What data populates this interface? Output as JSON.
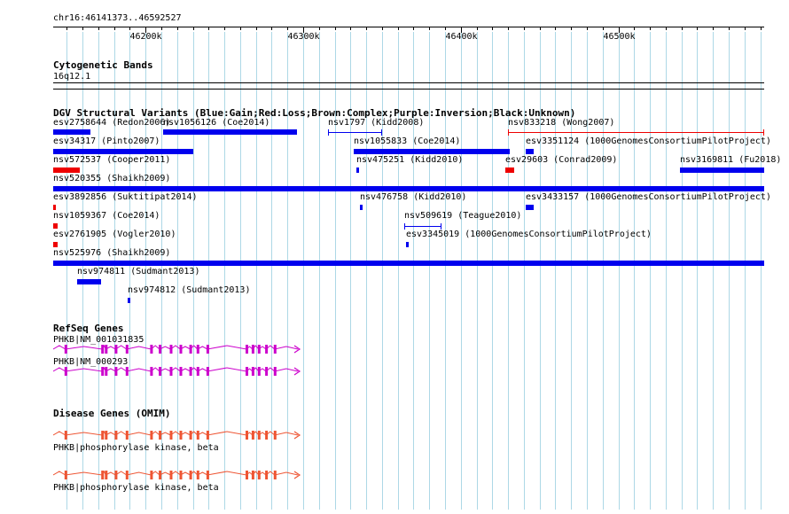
{
  "browser": {
    "location": "chr16:46141373..46592527",
    "ruler": {
      "start": 46141373,
      "end": 46592527,
      "ticks": [
        {
          "pos": 46200000,
          "label": "46200k"
        },
        {
          "pos": 46300000,
          "label": "46300k"
        },
        {
          "pos": 46400000,
          "label": "46400k"
        },
        {
          "pos": 46500000,
          "label": "46500k"
        }
      ]
    }
  },
  "colors": {
    "gain": "#0000ee",
    "loss": "#ee0000",
    "gridline": "#add8e6",
    "refseq": "#cc00cc",
    "omim": "#ee5533"
  },
  "tracks": {
    "cytoband": {
      "title": "Cytogenetic Bands",
      "band": "16q12.1"
    },
    "dgv": {
      "title": "DGV Structural Variants (Blue:Gain;Red:Loss;Brown:Complex;Purple:Inversion;Black:Unknown)",
      "features": [
        {
          "label": "esv2758644 (Redon2006)",
          "type": "gain",
          "style": "bar",
          "start": 46141373,
          "end": 46165000
        },
        {
          "label": "nsv1056126 (Coe2014)",
          "type": "gain",
          "style": "bar",
          "start": 46211000,
          "end": 46296000
        },
        {
          "label": "nsv1797 (Kidd2008)",
          "type": "gain",
          "style": "line",
          "start": 46316000,
          "end": 46350000
        },
        {
          "label": "nsv833218 (Wong2007)",
          "type": "loss",
          "style": "line",
          "start": 46430000,
          "end": 46592527
        },
        {
          "label": "esv34317 (Pinto2007)",
          "type": "gain",
          "style": "bar",
          "start": 46141373,
          "end": 46230000
        },
        {
          "label": "nsv1055833 (Coe2014)",
          "type": "gain",
          "style": "bar",
          "start": 46332000,
          "end": 46431000
        },
        {
          "label": "esv3351124 (1000GenomesConsortiumPilotProject)",
          "type": "gain",
          "style": "bar",
          "start": 46441000,
          "end": 46446000
        },
        {
          "label": "nsv572537 (Cooper2011)",
          "type": "loss",
          "style": "bar",
          "start": 46141373,
          "end": 46158000
        },
        {
          "label": "nsv475251 (Kidd2010)",
          "type": "gain",
          "style": "bar",
          "start": 46333500,
          "end": 46334800
        },
        {
          "label": "esv29603 (Conrad2009)",
          "type": "loss",
          "style": "bar",
          "start": 46428000,
          "end": 46434000
        },
        {
          "label": "nsv3169811 (Fu2018)",
          "type": "gain",
          "style": "bar",
          "start": 46539000,
          "end": 46592527
        },
        {
          "label": "nsv520355 (Shaikh2009)",
          "type": "gain",
          "style": "bar",
          "start": 46141373,
          "end": 46592527
        },
        {
          "label": "esv3892856 (Suktitipat2014)",
          "type": "loss",
          "style": "bar",
          "start": 46141373,
          "end": 46143000
        },
        {
          "label": "nsv476758 (Kidd2010)",
          "type": "gain",
          "style": "bar",
          "start": 46336000,
          "end": 46337300
        },
        {
          "label": "esv3433157 (1000GenomesConsortiumPilotProject)",
          "type": "gain",
          "style": "bar",
          "start": 46441000,
          "end": 46446000
        },
        {
          "label": "nsv1059367 (Coe2014)",
          "type": "loss",
          "style": "bar",
          "start": 46141373,
          "end": 46144000
        },
        {
          "label": "nsv509619 (Teague2010)",
          "type": "gain",
          "style": "line",
          "start": 46364000,
          "end": 46388000
        },
        {
          "label": "esv2761905 (Vogler2010)",
          "type": "loss",
          "style": "bar",
          "start": 46141373,
          "end": 46144000
        },
        {
          "label": "esv3345019 (1000GenomesConsortiumPilotProject)",
          "type": "gain",
          "style": "bar",
          "start": 46365000,
          "end": 46366300
        },
        {
          "label": "nsv525976 (Shaikh2009)",
          "type": "gain",
          "style": "bar",
          "start": 46141373,
          "end": 46592527
        },
        {
          "label": "nsv974811 (Sudmant2013)",
          "type": "gain",
          "style": "bar",
          "start": 46156500,
          "end": 46172000
        },
        {
          "label": "nsv974812 (Sudmant2013)",
          "type": "gain",
          "style": "bar",
          "start": 46188700,
          "end": 46190400
        }
      ]
    },
    "refseq": {
      "title": "RefSeq Genes",
      "genes": [
        {
          "label": "PHKB|NM_001031835",
          "start": 46141373,
          "end": 46298000
        },
        {
          "label": "PHKB|NM_000293",
          "start": 46141373,
          "end": 46298000
        }
      ]
    },
    "omim": {
      "title": "Disease Genes (OMIM)",
      "genes": [
        {
          "label": "PHKB|phosphorylase kinase, beta",
          "start": 46141373,
          "end": 46298000
        },
        {
          "label": "PHKB|phosphorylase kinase, beta",
          "start": 46141373,
          "end": 46298000
        }
      ]
    }
  }
}
